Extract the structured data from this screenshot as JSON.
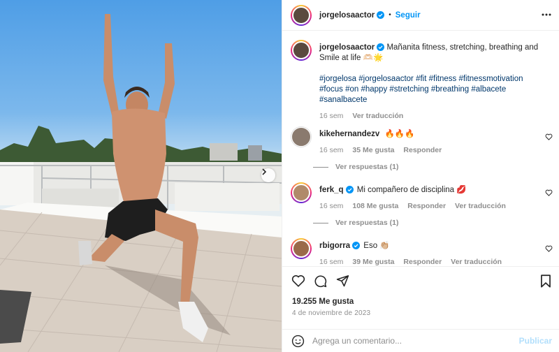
{
  "post": {
    "photo": {
      "image_name": "man-doing-lunge-stretch-on-rooftop"
    },
    "author": "jorgelosaactor",
    "follow_label": "Seguir",
    "separator": "•",
    "caption": "Mañanita fitness, stretching, breathing and Smile at life 🫶🏻🌟",
    "hashtags": "#jorgelosa #jorgelosaactor #fit #fitness #fitnessmotivation #focus #on #happy #stretching #breathing #albacete #sanalbacete",
    "caption_time": "16 sem",
    "caption_translate": "Ver traducción"
  },
  "comments": [
    {
      "user": "kikehernandezv",
      "verified": false,
      "text": "🔥🔥🔥",
      "time": "16 sem",
      "likes": "35 Me gusta",
      "reply": "Responder",
      "translate": "",
      "replies": "Ver respuestas (1)"
    },
    {
      "user": "ferk_q",
      "verified": true,
      "text": "Mi compañero de disciplina 💋",
      "time": "16 sem",
      "likes": "108 Me gusta",
      "reply": "Responder",
      "translate": "Ver traducción",
      "replies": "Ver respuestas (1)"
    },
    {
      "user": "rbigorra",
      "verified": true,
      "text": "Eso 👏🏼",
      "time": "16 sem",
      "likes": "39 Me gusta",
      "reply": "Responder",
      "translate": "Ver traducción",
      "replies": ""
    }
  ],
  "actions": {
    "icons": [
      "heart-icon",
      "comment-icon",
      "share-icon",
      "bookmark-icon"
    ],
    "likes": "19.255 Me gusta",
    "date": "4 de noviembre de 2023"
  },
  "add_comment": {
    "emoji_icon": "emoji-icon",
    "placeholder": "Agrega un comentario...",
    "publish": "Publicar"
  },
  "colors": {
    "link": "#0095f6",
    "hashtag": "#00376b",
    "muted": "#8e8e8e",
    "publish_disabled": "#b2dffc"
  }
}
